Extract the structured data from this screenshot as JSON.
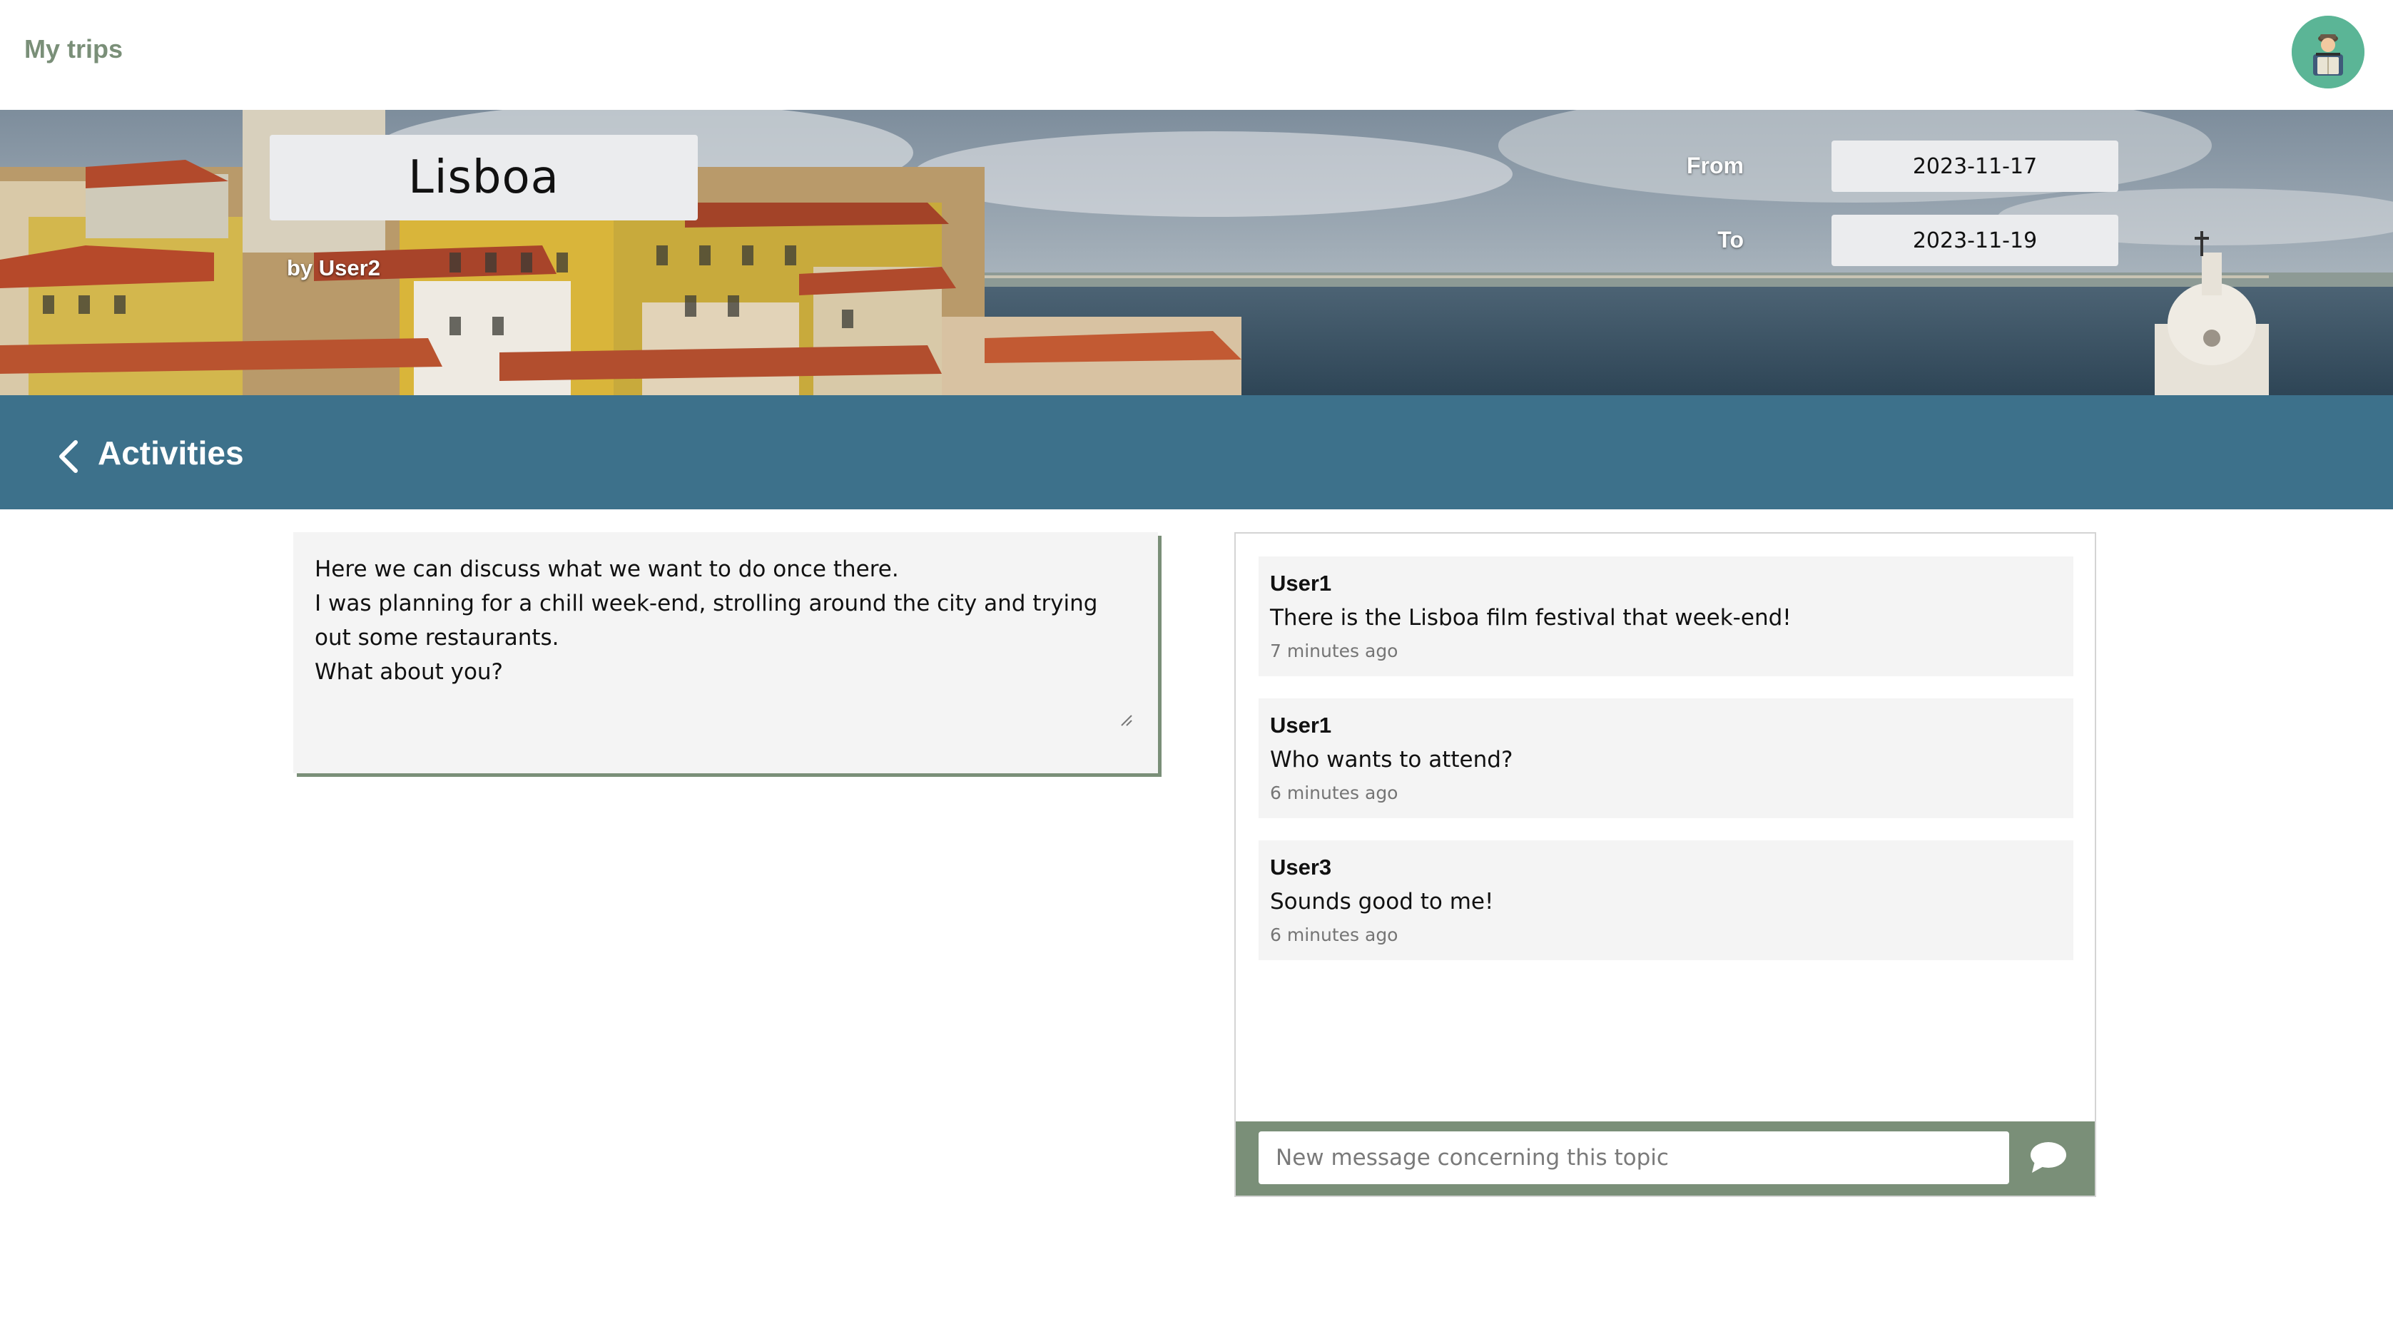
{
  "header": {
    "app_link": "My trips",
    "avatar_icon": "traveler-avatar-icon"
  },
  "trip": {
    "title": "Lisboa",
    "author": "by User2",
    "from_label": "From",
    "from_value": "2023-11-17",
    "to_label": "To",
    "to_value": "2023-11-19"
  },
  "section": {
    "title": "Activities",
    "back_icon": "chevron-left-icon"
  },
  "topic": {
    "description": "Here we can discuss what we want to do once there.\nI was planning for a chill week-end, strolling around the city and trying out some restaurants.\nWhat about you?"
  },
  "chat": {
    "messages": [
      {
        "user": "User1",
        "text": "There is the Lisboa film festival that week-end!",
        "time": "7 minutes ago"
      },
      {
        "user": "User1",
        "text": "Who wants to attend?",
        "time": "6 minutes ago"
      },
      {
        "user": "User3",
        "text": "Sounds good to me!",
        "time": "6 minutes ago"
      }
    ],
    "input_placeholder": "New message concerning this topic",
    "send_icon": "speech-bubble-icon"
  },
  "colors": {
    "accent_green": "#7a8f78",
    "section_blue": "#3d718b",
    "avatar_bg": "#5bb596"
  }
}
